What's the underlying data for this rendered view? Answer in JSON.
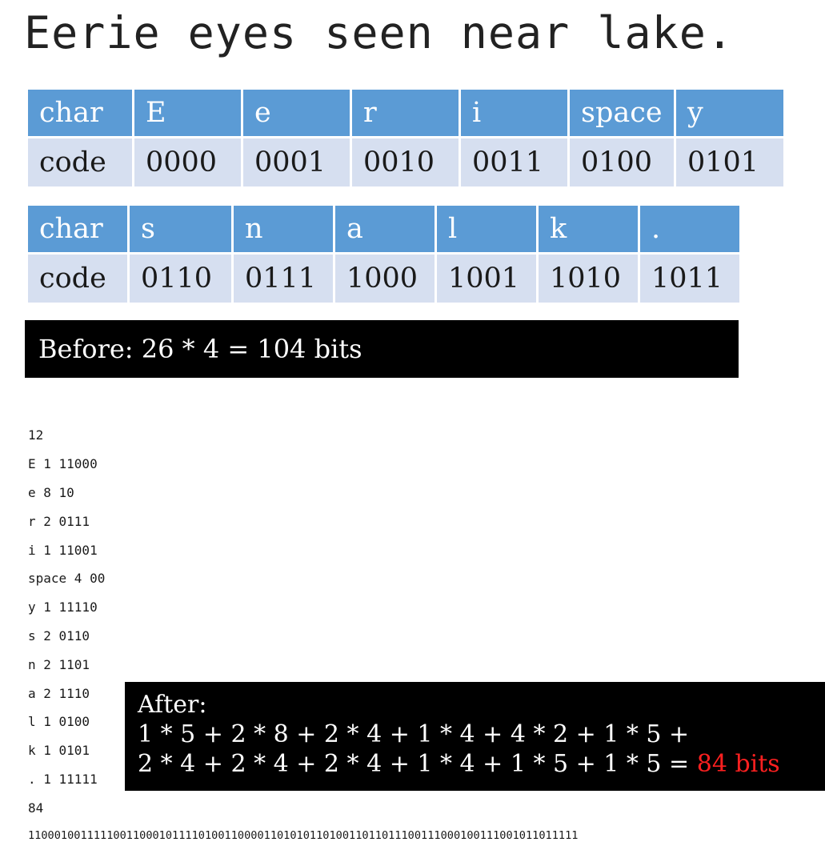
{
  "title": "Eerie eyes seen near lake.",
  "table1": {
    "header": [
      "char",
      "E",
      "e",
      "r",
      "i",
      "space",
      "y"
    ],
    "codes": [
      "code",
      "0000",
      "0001",
      "0010",
      "0011",
      "0100",
      "0101"
    ]
  },
  "table2": {
    "header": [
      "char",
      "s",
      "n",
      "a",
      "l",
      "k",
      "."
    ],
    "codes": [
      "code",
      "0110",
      "0111",
      "1000",
      "1001",
      "1010",
      "1011"
    ]
  },
  "before": "Before: 26 * 4 = 104 bits",
  "huffman": {
    "count": "12",
    "entries": [
      "E 1 11000",
      "e 8 10",
      "r 2 0111",
      "i 1 11001",
      "space 4 00",
      "y 1 11110",
      "s 2 0110",
      "n 2 1101",
      "a 2 1110",
      "l 1 0100",
      "k 1 0101",
      ". 1 11111"
    ],
    "total": "84",
    "bitstring": "110001001111100110001011110100110000110101011010011011011100111000100111001011011111"
  },
  "after": {
    "label": "After:",
    "line1": "1 * 5 + 2 * 8 + 2 * 4 + 1 * 4 + 4 * 2 + 1 * 5 +",
    "line2": "2 * 4 + 2 * 4 + 2 * 4 + 1 * 4 + 1 * 5 + 1 * 5 = ",
    "result": "84 bits"
  }
}
